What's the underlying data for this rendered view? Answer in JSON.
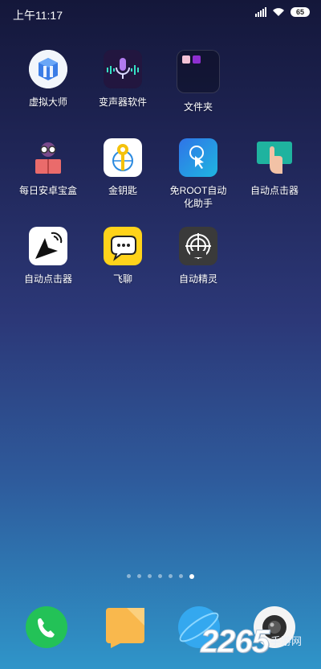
{
  "status_bar": {
    "time": "上午11:17",
    "battery": "65"
  },
  "apps": [
    {
      "label": "虚拟大师"
    },
    {
      "label": "变声器软件"
    },
    {
      "label": "文件夹"
    },
    {
      "label": "每日安卓宝盒"
    },
    {
      "label": "金钥匙"
    },
    {
      "label": "免ROOT自动\n化助手"
    },
    {
      "label": "自动点击器"
    },
    {
      "label": "自动点击器"
    },
    {
      "label": "飞聊"
    },
    {
      "label": "自动精灵"
    }
  ],
  "page_indicator": {
    "count": 7,
    "active_page": 7
  },
  "dock": [
    "phone-icon",
    "messages-icon",
    "browser-icon",
    "camera-icon"
  ],
  "watermark": {
    "number": "2265",
    "text": "手游网"
  }
}
